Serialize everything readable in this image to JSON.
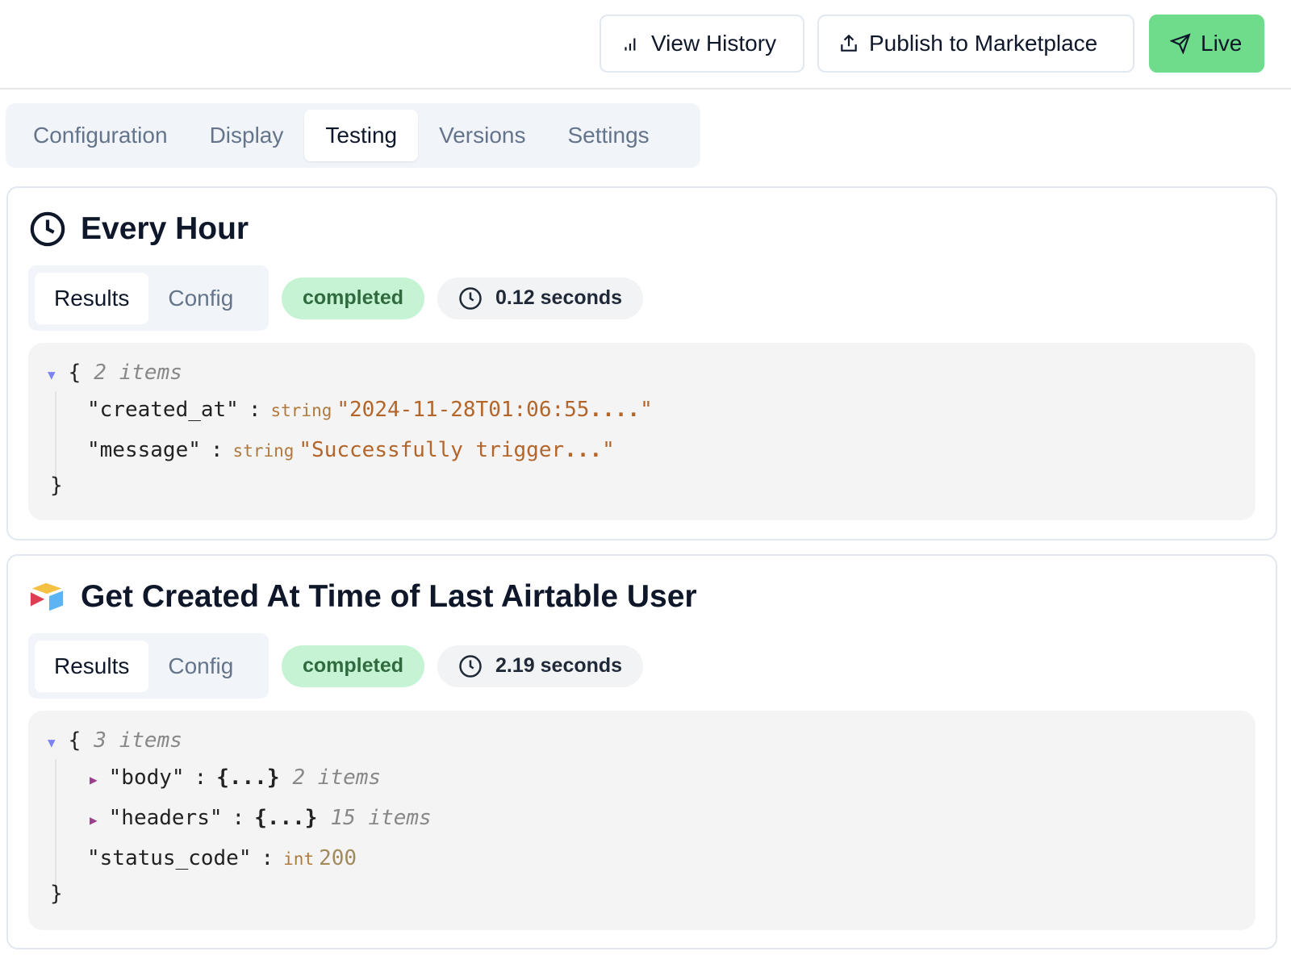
{
  "header": {
    "view_history": "View History",
    "publish": "Publish to Marketplace",
    "live": "Live",
    "live_color": "#6fdc8c"
  },
  "tabs": [
    "Configuration",
    "Display",
    "Testing",
    "Versions",
    "Settings"
  ],
  "active_tab": "Testing",
  "steps": [
    {
      "title": "Every Hour",
      "icon": "clock-icon",
      "subtabs": [
        "Results",
        "Config"
      ],
      "status": "completed",
      "duration": "0.12 seconds",
      "json": {
        "count": "2 items",
        "fields": [
          {
            "key": "\"created_at\"",
            "type": "string",
            "value": "\"2024-11-28T01:06:55",
            "ellipsis": "....",
            "close": "\""
          },
          {
            "key": "\"message\"",
            "type": "string",
            "value": "\"Successfully trigger",
            "ellipsis": "...",
            "close": "\""
          }
        ]
      }
    },
    {
      "title": "Get Created At Time of Last Airtable User",
      "icon": "airtable-logo-icon",
      "subtabs": [
        "Results",
        "Config"
      ],
      "status": "completed",
      "duration": "2.19 seconds",
      "json": {
        "count": "3 items",
        "fields": [
          {
            "key": "\"body\"",
            "collapsed": "{...}",
            "count": "2 items"
          },
          {
            "key": "\"headers\"",
            "collapsed": "{...}",
            "count": "15 items"
          },
          {
            "key": "\"status_code\"",
            "type": "int",
            "value": "200"
          }
        ]
      }
    }
  ],
  "json_open": "{",
  "json_close": "}",
  "colon": ":"
}
